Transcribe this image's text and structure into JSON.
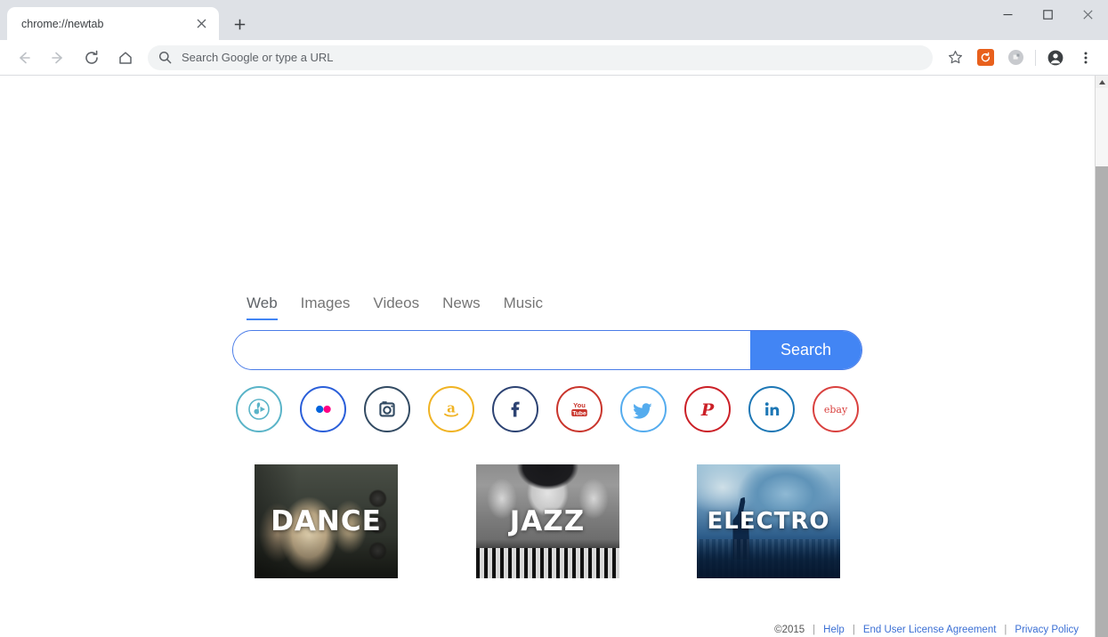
{
  "window": {
    "minimize_label": "Minimize",
    "maximize_label": "Maximize",
    "close_label": "Close"
  },
  "tabstrip": {
    "tab_title": "chrome://newtab",
    "close_tab_label": "×",
    "new_tab_label": "+"
  },
  "toolbar": {
    "back_label": "←",
    "forward_label": "→",
    "reload_label": "↻",
    "home_label": "⌂",
    "omnibox_placeholder": "Search Google or type a URL",
    "omnibox_value": "",
    "bookmark_label": "☆",
    "extension_1_name": "orange-extension",
    "extension_2_name": "grey-extension",
    "profile_label": "Profile",
    "menu_label": "⋮"
  },
  "search_page": {
    "tabs": [
      {
        "label": "Web",
        "active": true
      },
      {
        "label": "Images",
        "active": false
      },
      {
        "label": "Videos",
        "active": false
      },
      {
        "label": "News",
        "active": false
      },
      {
        "label": "Music",
        "active": false
      }
    ],
    "search_input_value": "",
    "search_input_placeholder": "",
    "search_button_label": "Search",
    "accent_color": "#4285f4",
    "socials": [
      {
        "name": "music-play-icon",
        "title": "Music",
        "color": "#5ab4c8"
      },
      {
        "name": "flickr-icon",
        "title": "Flickr",
        "color": "#2b5fd9"
      },
      {
        "name": "instagram-icon",
        "title": "Instagram",
        "color": "#334b63"
      },
      {
        "name": "amazon-icon",
        "title": "Amazon",
        "color": "#f0b323"
      },
      {
        "name": "facebook-icon",
        "title": "Facebook",
        "color": "#2d4373"
      },
      {
        "name": "youtube-icon",
        "title": "YouTube",
        "color": "#c9352c"
      },
      {
        "name": "twitter-icon",
        "title": "Twitter",
        "color": "#55acee"
      },
      {
        "name": "pinterest-icon",
        "title": "Pinterest",
        "color": "#cb2027"
      },
      {
        "name": "linkedin-icon",
        "title": "LinkedIn",
        "color": "#1d77b5"
      },
      {
        "name": "ebay-icon",
        "title": "eBay",
        "color": "#d9413f"
      }
    ],
    "cards": [
      {
        "label": "DANCE",
        "theme": "dance"
      },
      {
        "label": "JAZZ",
        "theme": "jazz"
      },
      {
        "label": "ELECTRO",
        "theme": "electro"
      }
    ]
  },
  "footer": {
    "copyright": "©2015",
    "sep": "|",
    "help": "Help",
    "eula": "End User License Agreement",
    "privacy": "Privacy Policy"
  }
}
